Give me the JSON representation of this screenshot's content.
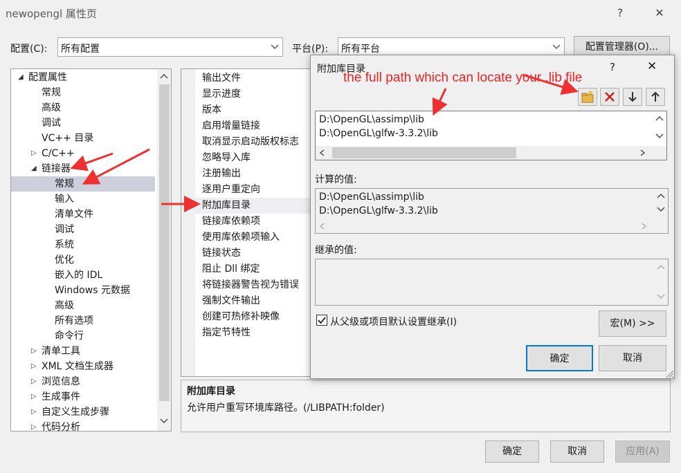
{
  "window": {
    "title": "newopengl 属性页",
    "help": "?",
    "close": "✕"
  },
  "config": {
    "label": "配置(C):",
    "value": "所有配置"
  },
  "platform": {
    "label": "平台(P):",
    "value": "所有平台"
  },
  "config_manager": "配置管理器(O)...",
  "tree": {
    "items": [
      {
        "label": "配置属性",
        "expander": "◢"
      },
      {
        "label": "常规"
      },
      {
        "label": "高级"
      },
      {
        "label": "调试"
      },
      {
        "label": "VC++ 目录"
      },
      {
        "label": "C/C++",
        "expander": "▷"
      },
      {
        "label": "链接器",
        "expander": "◢"
      },
      {
        "label": "常规"
      },
      {
        "label": "输入"
      },
      {
        "label": "清单文件"
      },
      {
        "label": "调试"
      },
      {
        "label": "系统"
      },
      {
        "label": "优化"
      },
      {
        "label": "嵌入的 IDL"
      },
      {
        "label": "Windows 元数据"
      },
      {
        "label": "高级"
      },
      {
        "label": "所有选项"
      },
      {
        "label": "命令行"
      },
      {
        "label": "清单工具",
        "expander": "▷"
      },
      {
        "label": "XML 文档生成器",
        "expander": "▷"
      },
      {
        "label": "浏览信息",
        "expander": "▷"
      },
      {
        "label": "生成事件",
        "expander": "▷"
      },
      {
        "label": "自定义生成步骤",
        "expander": "▷"
      },
      {
        "label": "代码分析",
        "expander": "▷"
      }
    ]
  },
  "props": {
    "items": [
      "输出文件",
      "显示进度",
      "版本",
      "启用增量链接",
      "取消显示启动版权标志",
      "忽略导入库",
      "注册输出",
      "逐用户重定向",
      "附加库目录",
      "链接库依赖项",
      "使用库依赖项输入",
      "链接状态",
      "阻止 Dll 绑定",
      "将链接器警告视为错误",
      "强制文件输出",
      "创建可热修补映像",
      "指定节特性"
    ]
  },
  "description": {
    "title": "附加库目录",
    "text": "允许用户重写环境库路径。(/LIBPATH:folder)"
  },
  "dialog": {
    "title": "附加库目录",
    "help": "?",
    "close": "✕",
    "entries": [
      "D:\\OpenGL\\assimp\\lib",
      "D:\\OpenGL\\glfw-3.3.2\\lib"
    ],
    "computed_label": "计算的值:",
    "computed": [
      "D:\\OpenGL\\assimp\\lib",
      "D:\\OpenGL\\glfw-3.3.2\\lib"
    ],
    "inherited_label": "继承的值:",
    "inherit_checkbox": "从父级或项目默认设置继承(I)",
    "inherit_checked": true,
    "macro_button": "宏(M) >>",
    "ok": "确定",
    "cancel": "取消"
  },
  "annotation": {
    "text": "the full path which can locate your .lib file",
    "color": "#ee2222"
  },
  "footer": {
    "ok": "确定",
    "cancel": "取消",
    "apply": "应用(A)"
  }
}
